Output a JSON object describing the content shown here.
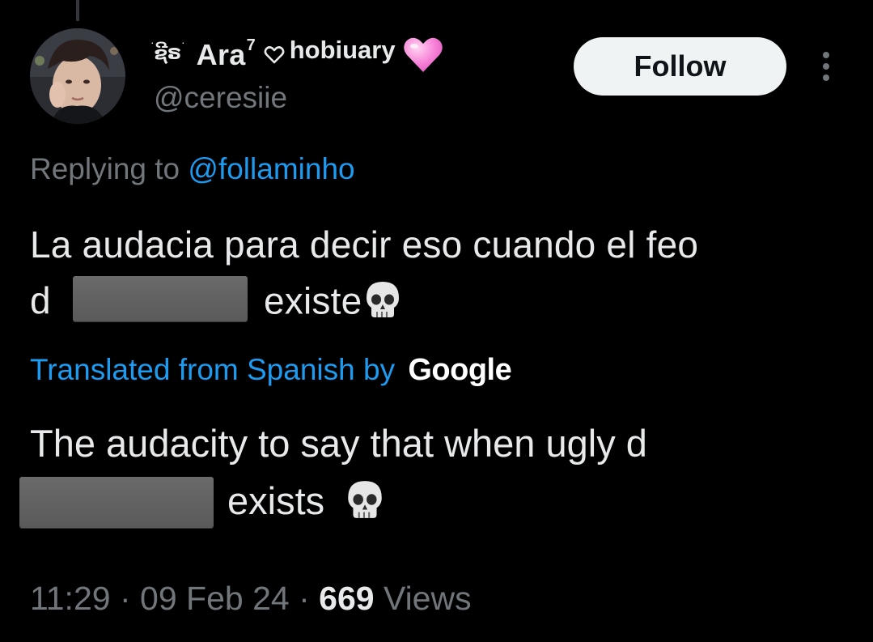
{
  "author": {
    "name_decor": "ຊີຣ",
    "name_main": "Ara",
    "name_sup": "7",
    "name_tail": "hobiuary",
    "handle": "@ceresiie"
  },
  "actions": {
    "follow_label": "Follow"
  },
  "reply": {
    "prefix": "Replying to ",
    "mention": "@follaminho"
  },
  "tweet": {
    "line1": "La audacia para decir eso cuando el feo",
    "line2_start": "d ",
    "line2_end": "existe"
  },
  "translation": {
    "label": "Translated from Spanish by ",
    "provider": "Google",
    "line1": "The audacity to say that when ugly d",
    "line2": "exists"
  },
  "meta": {
    "time": "11:29",
    "date": "09 Feb 24",
    "views_count": "669",
    "views_label": "Views"
  },
  "colors": {
    "background": "#000000",
    "text": "#e7e9ea",
    "muted": "#71767b",
    "link": "#1d9bf0",
    "follow_bg": "#eff3f4",
    "heart_pink": "#f783d8"
  },
  "icons": [
    "heart-outline-icon",
    "pink-heart-icon",
    "skull-icon",
    "more-options-icon"
  ]
}
